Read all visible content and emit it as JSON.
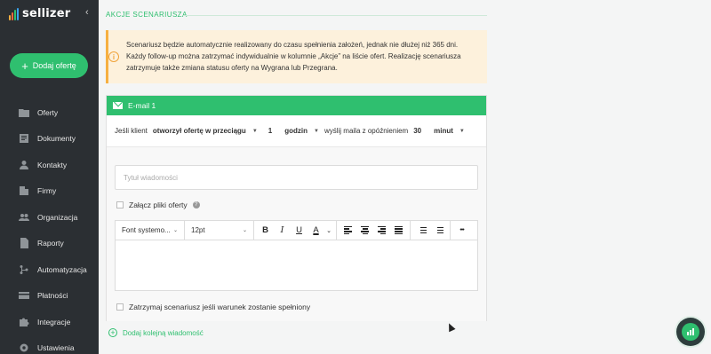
{
  "sidebar": {
    "logo_text": "sellizer",
    "logo_colors": [
      "#f6b042",
      "#f0693a",
      "#2fbf6f",
      "#3aa3f0"
    ],
    "collapse_icon": "chevron-left-icon",
    "add_offer_label": "Dodaj ofertę",
    "items": [
      {
        "label": "Oferty",
        "icon": "folder-icon"
      },
      {
        "label": "Dokumenty",
        "icon": "document-icon"
      },
      {
        "label": "Kontakty",
        "icon": "person-icon"
      },
      {
        "label": "Firmy",
        "icon": "building-icon"
      },
      {
        "label": "Organizacja",
        "icon": "people-icon"
      },
      {
        "label": "Raporty",
        "icon": "report-icon"
      },
      {
        "label": "Automatyzacja",
        "icon": "automation-icon"
      },
      {
        "label": "Płatności",
        "icon": "card-icon"
      },
      {
        "label": "Integracje",
        "icon": "puzzle-icon"
      },
      {
        "label": "Ustawienia",
        "icon": "gear-icon"
      }
    ]
  },
  "main": {
    "section_title": "AKCJE SCENARIUSZA",
    "info_text": "Scenariusz będzie automatycznie realizowany do czasu spełnienia założeń, jednak nie dłużej niż 365 dni. Każdy follow-up można zatrzymać indywidualnie w kolumnie „Akcje” na liście ofert. Realizację scenariusza zatrzymuje także zmiana statusu oferty na Wygrana lub Przegrana.",
    "email": {
      "header": "E-mail 1",
      "rule": {
        "prefix": "Jeśli klient",
        "action_value": "otworzył ofertę w przeciągu",
        "amount": "1",
        "unit_value": "godzin",
        "middle": "wyślij maila z opóźnieniem",
        "delay": "30",
        "delay_unit_value": "minut"
      },
      "subject_placeholder": "Tytuł wiadomości",
      "attach_label": "Załącz pliki oferty",
      "toolbar": {
        "font_value": "Font systemo...",
        "size_value": "12pt",
        "bold": "B",
        "italic": "I",
        "underline": "U",
        "color": "A",
        "more": "•••"
      },
      "stop_label": "Zatrzymaj scenariusz jeśli warunek zostanie spełniony"
    },
    "add_message_label": "Dodaj kolejną wiadomość"
  },
  "accent_color": "#2fbf6f"
}
